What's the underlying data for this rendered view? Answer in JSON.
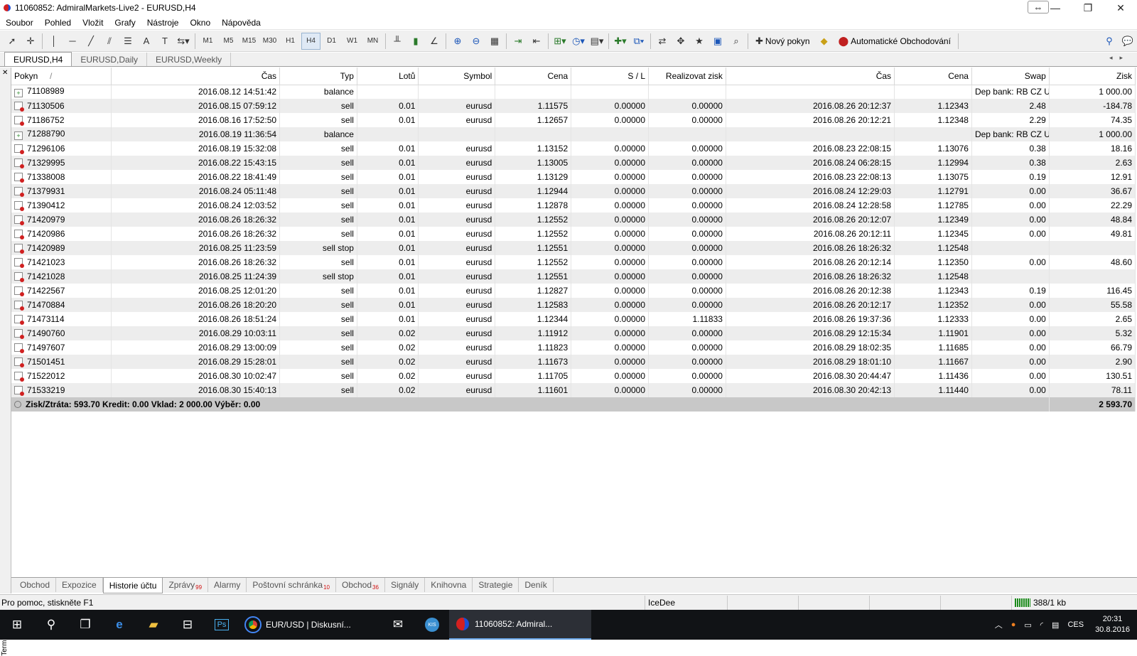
{
  "window": {
    "title": "11060852: AdmiralMarkets-Live2 - EURUSD,H4",
    "min_icon": "minimize-icon",
    "max_icon": "restore-icon",
    "close_icon": "close-icon",
    "resize_icon": "resize-icon"
  },
  "menu": [
    "Soubor",
    "Pohled",
    "Vložit",
    "Grafy",
    "Nástroje",
    "Okno",
    "Nápověda"
  ],
  "toolbar": {
    "timeframes": [
      "M1",
      "M5",
      "M15",
      "M30",
      "H1",
      "H4",
      "D1",
      "W1",
      "MN"
    ],
    "active_timeframe": "H4",
    "new_order": "Nový pokyn",
    "auto_trading": "Automatické Obchodování"
  },
  "chart_tabs": [
    {
      "label": "EURUSD,H4",
      "active": true
    },
    {
      "label": "EURUSD,Daily",
      "active": false
    },
    {
      "label": "EURUSD,Weekly",
      "active": false
    }
  ],
  "table": {
    "columns": [
      "Pokyn",
      "Čas",
      "Typ",
      "Lotů",
      "Symbol",
      "Cena",
      "S / L",
      "Realizovat zisk",
      "Čas",
      "Cena",
      "Swap",
      "Zisk"
    ],
    "sort_indicator": "/",
    "rows": [
      {
        "pokyn": "71108989",
        "cas": "2016.08.12 14:51:42",
        "typ": "balance",
        "lotu": "",
        "symbol": "",
        "cena": "",
        "sl": "",
        "tp": "",
        "cas2": "",
        "cena2": "",
        "swap": "Dep bank: RB CZ UK",
        "zisk": "1 000.00",
        "kind": "balance"
      },
      {
        "pokyn": "71130506",
        "cas": "2016.08.15 07:59:12",
        "typ": "sell",
        "lotu": "0.01",
        "symbol": "eurusd",
        "cena": "1.11575",
        "sl": "0.00000",
        "tp": "0.00000",
        "cas2": "2016.08.26 20:12:37",
        "cena2": "1.12343",
        "swap": "2.48",
        "zisk": "-184.78",
        "kind": "trade"
      },
      {
        "pokyn": "71186752",
        "cas": "2016.08.16 17:52:50",
        "typ": "sell",
        "lotu": "0.01",
        "symbol": "eurusd",
        "cena": "1.12657",
        "sl": "0.00000",
        "tp": "0.00000",
        "cas2": "2016.08.26 20:12:21",
        "cena2": "1.12348",
        "swap": "2.29",
        "zisk": "74.35",
        "kind": "trade"
      },
      {
        "pokyn": "71288790",
        "cas": "2016.08.19 11:36:54",
        "typ": "balance",
        "lotu": "",
        "symbol": "",
        "cena": "",
        "sl": "",
        "tp": "",
        "cas2": "",
        "cena2": "",
        "swap": "Dep bank: RB CZ UK",
        "zisk": "1 000.00",
        "kind": "balance"
      },
      {
        "pokyn": "71296106",
        "cas": "2016.08.19 15:32:08",
        "typ": "sell",
        "lotu": "0.01",
        "symbol": "eurusd",
        "cena": "1.13152",
        "sl": "0.00000",
        "tp": "0.00000",
        "cas2": "2016.08.23 22:08:15",
        "cena2": "1.13076",
        "swap": "0.38",
        "zisk": "18.16",
        "kind": "trade"
      },
      {
        "pokyn": "71329995",
        "cas": "2016.08.22 15:43:15",
        "typ": "sell",
        "lotu": "0.01",
        "symbol": "eurusd",
        "cena": "1.13005",
        "sl": "0.00000",
        "tp": "0.00000",
        "cas2": "2016.08.24 06:28:15",
        "cena2": "1.12994",
        "swap": "0.38",
        "zisk": "2.63",
        "kind": "trade"
      },
      {
        "pokyn": "71338008",
        "cas": "2016.08.22 18:41:49",
        "typ": "sell",
        "lotu": "0.01",
        "symbol": "eurusd",
        "cena": "1.13129",
        "sl": "0.00000",
        "tp": "0.00000",
        "cas2": "2016.08.23 22:08:13",
        "cena2": "1.13075",
        "swap": "0.19",
        "zisk": "12.91",
        "kind": "trade"
      },
      {
        "pokyn": "71379931",
        "cas": "2016.08.24 05:11:48",
        "typ": "sell",
        "lotu": "0.01",
        "symbol": "eurusd",
        "cena": "1.12944",
        "sl": "0.00000",
        "tp": "0.00000",
        "cas2": "2016.08.24 12:29:03",
        "cena2": "1.12791",
        "swap": "0.00",
        "zisk": "36.67",
        "kind": "trade"
      },
      {
        "pokyn": "71390412",
        "cas": "2016.08.24 12:03:52",
        "typ": "sell",
        "lotu": "0.01",
        "symbol": "eurusd",
        "cena": "1.12878",
        "sl": "0.00000",
        "tp": "0.00000",
        "cas2": "2016.08.24 12:28:58",
        "cena2": "1.12785",
        "swap": "0.00",
        "zisk": "22.29",
        "kind": "trade"
      },
      {
        "pokyn": "71420979",
        "cas": "2016.08.26 18:26:32",
        "typ": "sell",
        "lotu": "0.01",
        "symbol": "eurusd",
        "cena": "1.12552",
        "sl": "0.00000",
        "tp": "0.00000",
        "cas2": "2016.08.26 20:12:07",
        "cena2": "1.12349",
        "swap": "0.00",
        "zisk": "48.84",
        "kind": "trade"
      },
      {
        "pokyn": "71420986",
        "cas": "2016.08.26 18:26:32",
        "typ": "sell",
        "lotu": "0.01",
        "symbol": "eurusd",
        "cena": "1.12552",
        "sl": "0.00000",
        "tp": "0.00000",
        "cas2": "2016.08.26 20:12:11",
        "cena2": "1.12345",
        "swap": "0.00",
        "zisk": "49.81",
        "kind": "trade"
      },
      {
        "pokyn": "71420989",
        "cas": "2016.08.25 11:23:59",
        "typ": "sell stop",
        "lotu": "0.01",
        "symbol": "eurusd",
        "cena": "1.12551",
        "sl": "0.00000",
        "tp": "0.00000",
        "cas2": "2016.08.26 18:26:32",
        "cena2": "1.12548",
        "swap": "",
        "zisk": "",
        "kind": "trade"
      },
      {
        "pokyn": "71421023",
        "cas": "2016.08.26 18:26:32",
        "typ": "sell",
        "lotu": "0.01",
        "symbol": "eurusd",
        "cena": "1.12552",
        "sl": "0.00000",
        "tp": "0.00000",
        "cas2": "2016.08.26 20:12:14",
        "cena2": "1.12350",
        "swap": "0.00",
        "zisk": "48.60",
        "kind": "trade"
      },
      {
        "pokyn": "71421028",
        "cas": "2016.08.25 11:24:39",
        "typ": "sell stop",
        "lotu": "0.01",
        "symbol": "eurusd",
        "cena": "1.12551",
        "sl": "0.00000",
        "tp": "0.00000",
        "cas2": "2016.08.26 18:26:32",
        "cena2": "1.12548",
        "swap": "",
        "zisk": "",
        "kind": "trade"
      },
      {
        "pokyn": "71422567",
        "cas": "2016.08.25 12:01:20",
        "typ": "sell",
        "lotu": "0.01",
        "symbol": "eurusd",
        "cena": "1.12827",
        "sl": "0.00000",
        "tp": "0.00000",
        "cas2": "2016.08.26 20:12:38",
        "cena2": "1.12343",
        "swap": "0.19",
        "zisk": "116.45",
        "kind": "trade"
      },
      {
        "pokyn": "71470884",
        "cas": "2016.08.26 18:20:20",
        "typ": "sell",
        "lotu": "0.01",
        "symbol": "eurusd",
        "cena": "1.12583",
        "sl": "0.00000",
        "tp": "0.00000",
        "cas2": "2016.08.26 20:12:17",
        "cena2": "1.12352",
        "swap": "0.00",
        "zisk": "55.58",
        "kind": "trade"
      },
      {
        "pokyn": "71473114",
        "cas": "2016.08.26 18:51:24",
        "typ": "sell",
        "lotu": "0.01",
        "symbol": "eurusd",
        "cena": "1.12344",
        "sl": "0.00000",
        "tp": "1.11833",
        "cas2": "2016.08.26 19:37:36",
        "cena2": "1.12333",
        "swap": "0.00",
        "zisk": "2.65",
        "kind": "trade"
      },
      {
        "pokyn": "71490760",
        "cas": "2016.08.29 10:03:11",
        "typ": "sell",
        "lotu": "0.02",
        "symbol": "eurusd",
        "cena": "1.11912",
        "sl": "0.00000",
        "tp": "0.00000",
        "cas2": "2016.08.29 12:15:34",
        "cena2": "1.11901",
        "swap": "0.00",
        "zisk": "5.32",
        "kind": "trade"
      },
      {
        "pokyn": "71497607",
        "cas": "2016.08.29 13:00:09",
        "typ": "sell",
        "lotu": "0.02",
        "symbol": "eurusd",
        "cena": "1.11823",
        "sl": "0.00000",
        "tp": "0.00000",
        "cas2": "2016.08.29 18:02:35",
        "cena2": "1.11685",
        "swap": "0.00",
        "zisk": "66.79",
        "kind": "trade"
      },
      {
        "pokyn": "71501451",
        "cas": "2016.08.29 15:28:01",
        "typ": "sell",
        "lotu": "0.02",
        "symbol": "eurusd",
        "cena": "1.11673",
        "sl": "0.00000",
        "tp": "0.00000",
        "cas2": "2016.08.29 18:01:10",
        "cena2": "1.11667",
        "swap": "0.00",
        "zisk": "2.90",
        "kind": "trade"
      },
      {
        "pokyn": "71522012",
        "cas": "2016.08.30 10:02:47",
        "typ": "sell",
        "lotu": "0.02",
        "symbol": "eurusd",
        "cena": "1.11705",
        "sl": "0.00000",
        "tp": "0.00000",
        "cas2": "2016.08.30 20:44:47",
        "cena2": "1.11436",
        "swap": "0.00",
        "zisk": "130.51",
        "kind": "trade"
      },
      {
        "pokyn": "71533219",
        "cas": "2016.08.30 15:40:13",
        "typ": "sell",
        "lotu": "0.02",
        "symbol": "eurusd",
        "cena": "1.11601",
        "sl": "0.00000",
        "tp": "0.00000",
        "cas2": "2016.08.30 20:42:13",
        "cena2": "1.11440",
        "swap": "0.00",
        "zisk": "78.11",
        "kind": "trade"
      }
    ],
    "summary": {
      "text": "Zisk/Ztráta: 593.70  Kredit: 0.00  Vklad: 2 000.00  Výběr: 0.00",
      "total": "2 593.70"
    }
  },
  "terminal_label": "Terminál",
  "bottom_tabs": [
    {
      "label": "Obchod",
      "badge": ""
    },
    {
      "label": "Expozice",
      "badge": ""
    },
    {
      "label": "Historie účtu",
      "badge": "",
      "active": true
    },
    {
      "label": "Zprávy",
      "badge": "99"
    },
    {
      "label": "Alarmy",
      "badge": ""
    },
    {
      "label": "Poštovní schránka",
      "badge": "10"
    },
    {
      "label": "Obchod",
      "badge": "36"
    },
    {
      "label": "Signály",
      "badge": ""
    },
    {
      "label": "Knihovna",
      "badge": ""
    },
    {
      "label": "Strategie",
      "badge": ""
    },
    {
      "label": "Deník",
      "badge": ""
    }
  ],
  "status": {
    "help": "Pro pomoc, stiskněte F1",
    "profile": "IceDee",
    "traffic": "388/1 kb"
  },
  "taskbar": {
    "apps": [
      {
        "label": "EUR/USD | Diskusní...",
        "icon": "chrome-icon",
        "active": false
      },
      {
        "label": "11060852: Admiral...",
        "icon": "metatrader-icon",
        "active": true
      }
    ],
    "ps_label": "Ps",
    "kis_label": "KIS",
    "lang": "CES",
    "time": "20:31",
    "date": "30.8.2016"
  }
}
